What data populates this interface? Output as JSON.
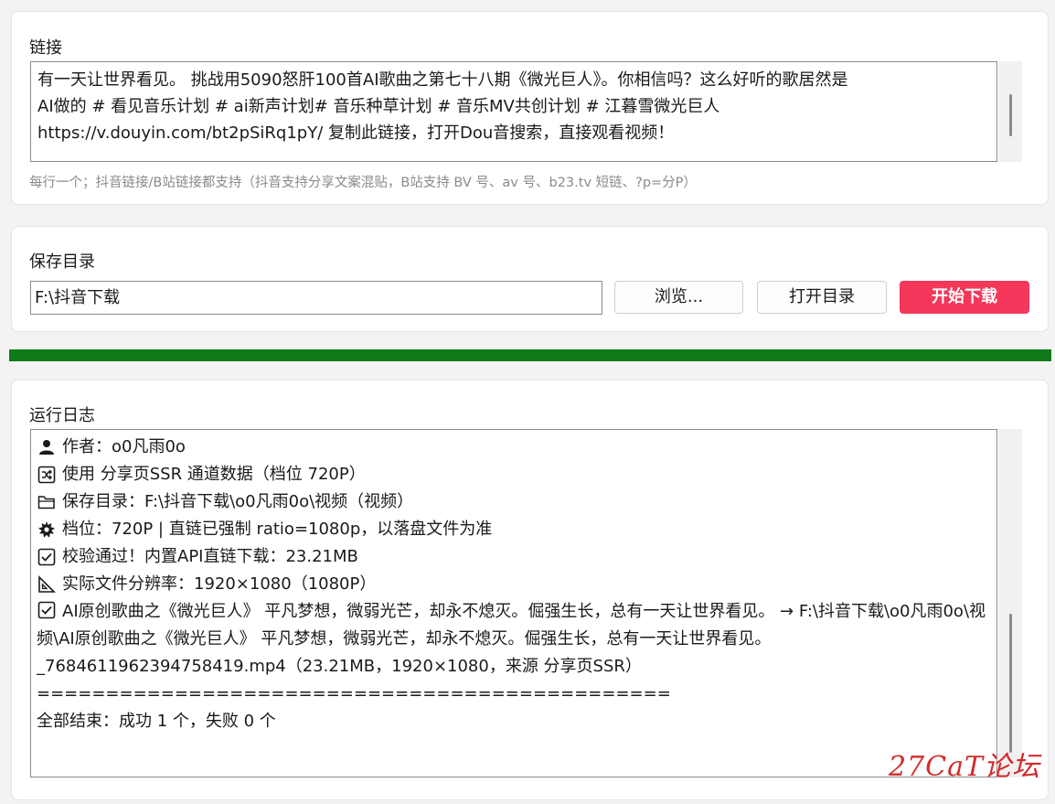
{
  "links": {
    "label": "链接",
    "lines": [
      "有一天让世界看见。 挑战用5090怒肝100首AI歌曲之第七十八期《微光巨人》。你相信吗？这么好听的歌居然是",
      "AI做的 # 看见音乐计划 # ai新声计划# 音乐种草计划 # 音乐MV共创计划 # 江暮雪微光巨人",
      "https://v.douyin.com/bt2pSiRq1pY/ 复制此链接，打开Dou音搜索，直接观看视频！"
    ],
    "hint": "每行一个；抖音链接/B站链接都支持（抖音支持分享文案混贴，B站支持 BV 号、av 号、b23.tv 短链、?p=分P）"
  },
  "save": {
    "label": "保存目录",
    "path": "F:\\抖音下载",
    "browse_label": "浏览...",
    "open_label": "打开目录",
    "start_label": "开始下载"
  },
  "progress": {
    "percent": 100,
    "color": "#0e7a18"
  },
  "log": {
    "label": "运行日志",
    "entries": [
      {
        "icon": "person-icon",
        "text": "作者：o0凡雨0o"
      },
      {
        "icon": "shuffle-icon",
        "text": "使用 分享页SSR 通道数据（档位 720P）"
      },
      {
        "icon": "folder-icon",
        "text": "保存目录：F:\\抖音下载\\o0凡雨0o\\视频（视频）"
      },
      {
        "icon": "gear-icon",
        "text": "档位：720P | 直链已强制 ratio=1080p，以落盘文件为准"
      },
      {
        "icon": "check-box-icon",
        "text": "校验通过！内置API直链下载：23.21MB"
      },
      {
        "icon": "triangle-ruler-icon",
        "text": "实际文件分辨率：1920×1080（1080P）"
      },
      {
        "icon": "check-box-icon",
        "text": "AI原创歌曲之《微光巨人》 平凡梦想，微弱光芒，却永不熄灭。倔强生长，总有一天让世界看见。 → F:\\抖音下载\\o0凡雨0o\\视频\\AI原创歌曲之《微光巨人》 平凡梦想，微弱光芒，却永不熄灭。倔强生长，总有一天让世界看见。_7684611962394758419.mp4（23.21MB，1920×1080，来源 分享页SSR）"
      },
      {
        "icon": "",
        "text": "=============================================="
      },
      {
        "icon": "",
        "text": "全部结束：成功 1 个，失败 0 个"
      }
    ]
  },
  "watermark": "27CaT论坛",
  "colors": {
    "accent": "#f4375a",
    "progress": "#0e7a18"
  }
}
